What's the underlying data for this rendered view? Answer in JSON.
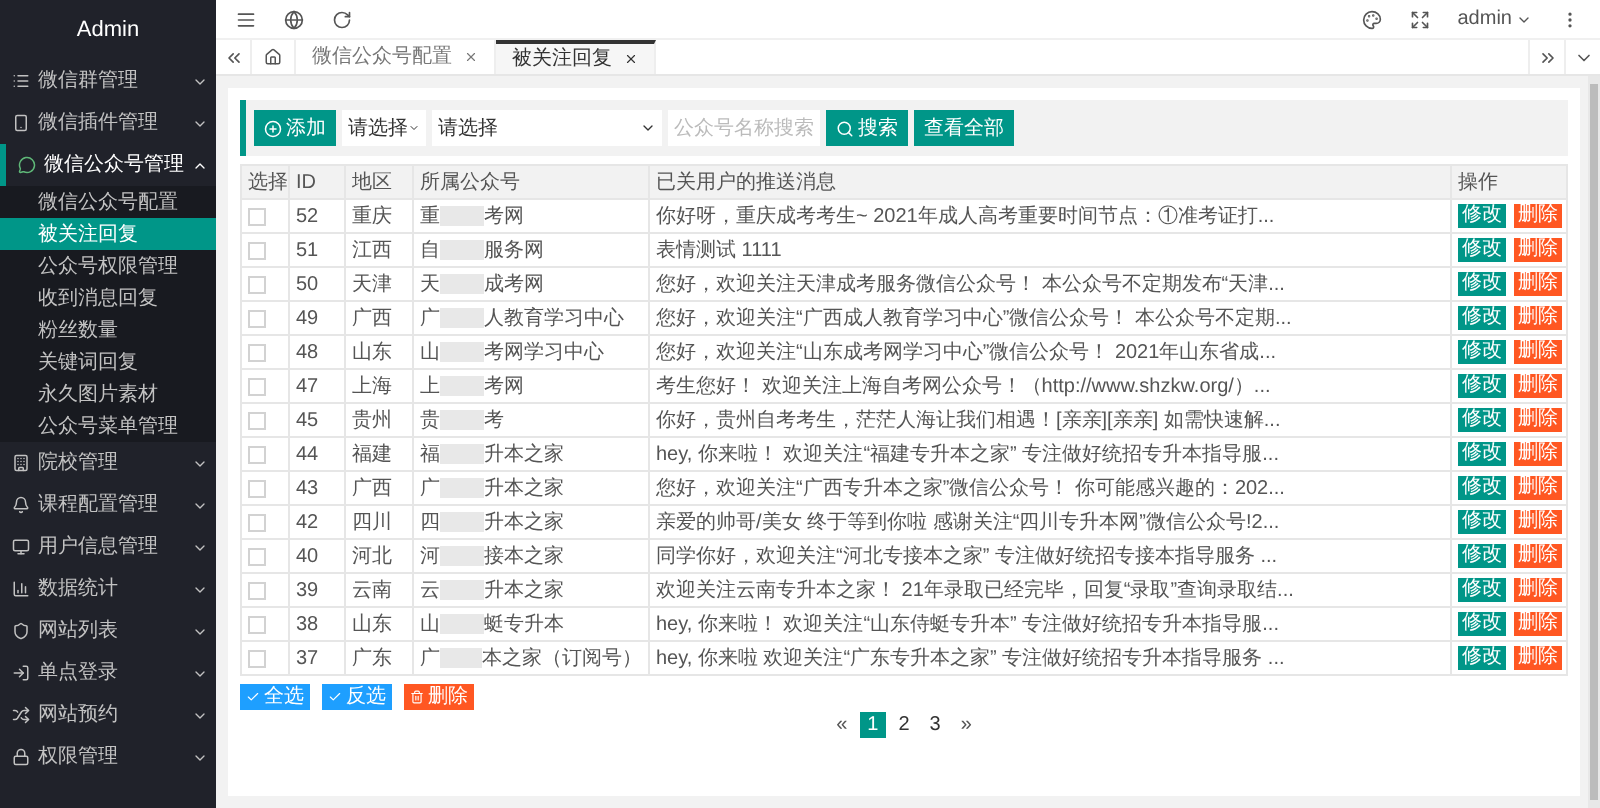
{
  "sidebar": {
    "title": "Admin",
    "items": [
      {
        "label": "微信群管理",
        "expanded": false
      },
      {
        "label": "微信插件管理",
        "expanded": false
      },
      {
        "label": "微信公众号管理",
        "expanded": true,
        "children": [
          {
            "label": "微信公众号配置",
            "selected": false
          },
          {
            "label": "被关注回复",
            "selected": true
          },
          {
            "label": "公众号权限管理",
            "selected": false
          },
          {
            "label": "收到消息回复",
            "selected": false
          },
          {
            "label": "粉丝数量",
            "selected": false
          },
          {
            "label": "关键词回复",
            "selected": false
          },
          {
            "label": "永久图片素材",
            "selected": false
          },
          {
            "label": "公众号菜单管理",
            "selected": false
          }
        ]
      },
      {
        "label": "院校管理",
        "expanded": false
      },
      {
        "label": "课程配置管理",
        "expanded": false
      },
      {
        "label": "用户信息管理",
        "expanded": false
      },
      {
        "label": "数据统计",
        "expanded": false
      },
      {
        "label": "网站列表",
        "expanded": false
      },
      {
        "label": "单点登录",
        "expanded": false
      },
      {
        "label": "网站预约",
        "expanded": false
      },
      {
        "label": "权限管理",
        "expanded": false
      }
    ]
  },
  "topbar": {
    "user": "admin"
  },
  "tabs": [
    {
      "label": "微信公众号配置",
      "selected": false
    },
    {
      "label": "被关注回复",
      "selected": true
    }
  ],
  "toolbar": {
    "add_label": "添加",
    "selects": [
      {
        "value": "请选择"
      },
      {
        "value": "请选择"
      }
    ],
    "search": {
      "placeholder": "公众号名称搜索"
    },
    "search_label": "搜索",
    "view_all_label": "查看全部"
  },
  "table": {
    "columns": [
      "选择",
      "ID",
      "地区",
      "所属公众号",
      "已关用户的推送消息",
      "操作"
    ],
    "rows": [
      {
        "checked": false,
        "id": "52",
        "region": "重庆",
        "account_head": "重",
        "account_tail": "考网",
        "message": "你好呀，重庆成考考生~ 2021年成人高考重要时间节点：①准考证打...",
        "edit_label": "修改",
        "delete_label": "删除"
      },
      {
        "checked": false,
        "id": "51",
        "region": "江西",
        "account_head": "自",
        "account_tail": "服务网",
        "message": "表情测试 1111",
        "edit_label": "修改",
        "delete_label": "删除"
      },
      {
        "checked": false,
        "id": "50",
        "region": "天津",
        "account_head": "天",
        "account_tail": "成考网",
        "message": "您好，欢迎关注天津成考服务微信公众号！ 本公众号不定期发布“天津...",
        "edit_label": "修改",
        "delete_label": "删除"
      },
      {
        "checked": false,
        "id": "49",
        "region": "广西",
        "account_head": "广",
        "account_tail": "人教育学习中心",
        "message": "您好，欢迎关注“广西成人教育学习中心”微信公众号！ 本公众号不定期...",
        "edit_label": "修改",
        "delete_label": "删除"
      },
      {
        "checked": false,
        "id": "48",
        "region": "山东",
        "account_head": "山",
        "account_tail": "考网学习中心",
        "message": "您好，欢迎关注“山东成考网学习中心”微信公众号！ 2021年山东省成...",
        "edit_label": "修改",
        "delete_label": "删除"
      },
      {
        "checked": false,
        "id": "47",
        "region": "上海",
        "account_head": "上",
        "account_tail": "考网",
        "message": "考生您好！ 欢迎关注上海自考网公众号！（http://www.shzkw.org/）...",
        "edit_label": "修改",
        "delete_label": "删除"
      },
      {
        "checked": false,
        "id": "45",
        "region": "贵州",
        "account_head": "贵",
        "account_tail": "考",
        "message": "你好，贵州自考考生，茫茫人海让我们相遇！[亲亲][亲亲] 如需快速解...",
        "edit_label": "修改",
        "delete_label": "删除"
      },
      {
        "checked": false,
        "id": "44",
        "region": "福建",
        "account_head": "福",
        "account_tail": "升本之家",
        "message": "hey, 你来啦！ 欢迎关注“福建专升本之家” 专注做好统招专升本指导服...",
        "edit_label": "修改",
        "delete_label": "删除"
      },
      {
        "checked": false,
        "id": "43",
        "region": "广西",
        "account_head": "广",
        "account_tail": "升本之家",
        "message": "您好，欢迎关注“广西专升本之家”微信公众号！ 你可能感兴趣的：202...",
        "edit_label": "修改",
        "delete_label": "删除"
      },
      {
        "checked": false,
        "id": "42",
        "region": "四川",
        "account_head": "四",
        "account_tail": "升本之家",
        "message": "亲爱的帅哥/美女 终于等到你啦 感谢关注“四川专升本网”微信公众号!2...",
        "edit_label": "修改",
        "delete_label": "删除"
      },
      {
        "checked": false,
        "id": "40",
        "region": "河北",
        "account_head": "河",
        "account_tail": "接本之家",
        "message": "同学你好，欢迎关注“河北专接本之家” 专注做好统招专接本指导服务 ...",
        "edit_label": "修改",
        "delete_label": "删除"
      },
      {
        "checked": false,
        "id": "39",
        "region": "云南",
        "account_head": "云",
        "account_tail": "升本之家",
        "message": "欢迎关注云南专升本之家！ 21年录取已经完毕，回复“录取”查询录取结...",
        "edit_label": "修改",
        "delete_label": "删除"
      },
      {
        "checked": false,
        "id": "38",
        "region": "山东",
        "account_head": "山",
        "account_tail": "蜓专升本",
        "message": "hey, 你来啦！ 欢迎关注“山东侍蜓专升本” 专注做好统招专升本指导服...",
        "edit_label": "修改",
        "delete_label": "删除"
      },
      {
        "checked": false,
        "id": "37",
        "region": "广东",
        "account_head": "广",
        "account_tail": "本之家（订阅号）",
        "message": "hey, 你来啦 欢迎关注“广东专升本之家” 专注做好统招专升本指导服务 ...",
        "edit_label": "修改",
        "delete_label": "删除"
      }
    ]
  },
  "bulk_actions": [
    {
      "label": "全选",
      "kind": "select"
    },
    {
      "label": "反选",
      "kind": "select"
    },
    {
      "label": "删除",
      "kind": "danger"
    }
  ],
  "pagination": {
    "prev": "«",
    "pages": [
      {
        "label": "1",
        "selected": true
      },
      {
        "label": "2",
        "selected": false
      },
      {
        "label": "3",
        "selected": false
      }
    ],
    "next": "»"
  }
}
